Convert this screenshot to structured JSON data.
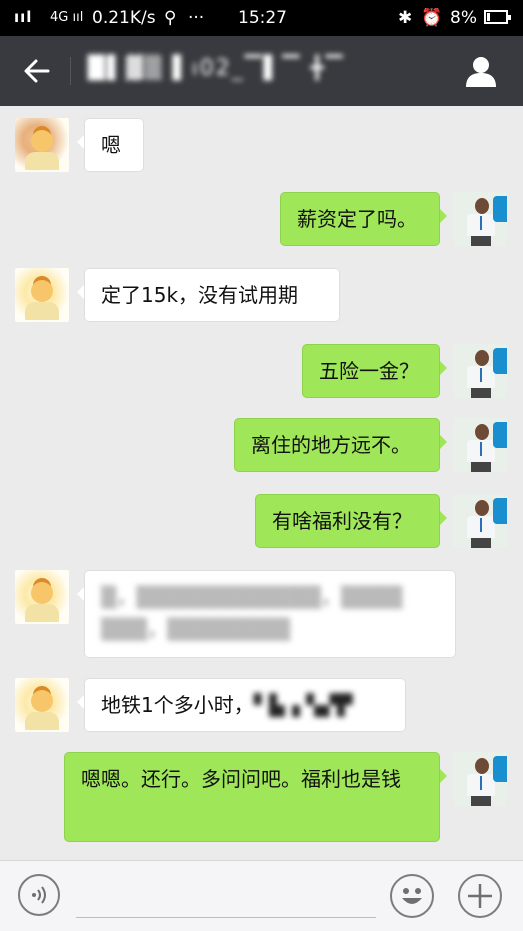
{
  "status_bar": {
    "signal": "ııl",
    "network": "4G ııl",
    "speed": "0.21K/s",
    "usb_icon": "usb-icon",
    "more": "···",
    "time": "15:27",
    "bluetooth_icon": "bluetooth-icon",
    "alarm_icon": "alarm-icon",
    "battery": "8%"
  },
  "header": {
    "title": "█▌▓▒ ▌ı02_▔▌▔ ╋▔",
    "back_icon": "arrow-left-icon",
    "profile_icon": "person-icon",
    "background": "#393a3f"
  },
  "messages": [
    {
      "side": "left",
      "text": "嗯"
    },
    {
      "side": "right",
      "text": "薪资定了吗。"
    },
    {
      "side": "left",
      "text": "定了15k，没有试用期"
    },
    {
      "side": "right",
      "text": "五险一金？"
    },
    {
      "side": "right",
      "text": "离住的地方远不。"
    },
    {
      "side": "right",
      "text": "有啥福利没有？"
    },
    {
      "side": "left",
      "text": "▒，▒▒▒▒▒▒▒▒▒▒▒▒，▒▒▒▒ ▒▒▒，▒▒▒▒▒▒▒▒",
      "blurred": true
    },
    {
      "side": "left",
      "text": "地铁1个多小时，",
      "tail": "▘▙▗ ▚▞▛",
      "blurred_tail": true
    },
    {
      "side": "right",
      "text": "嗯嗯。还行。多问问吧。福利也是钱"
    }
  ],
  "input_bar": {
    "voice_icon": "voice-icon",
    "emoji_icon": "emoji-icon",
    "plus_icon": "plus-icon"
  },
  "colors": {
    "chat_bg": "#ebebeb",
    "bubble_sent": "#9fe658",
    "bubble_received": "#ffffff"
  }
}
